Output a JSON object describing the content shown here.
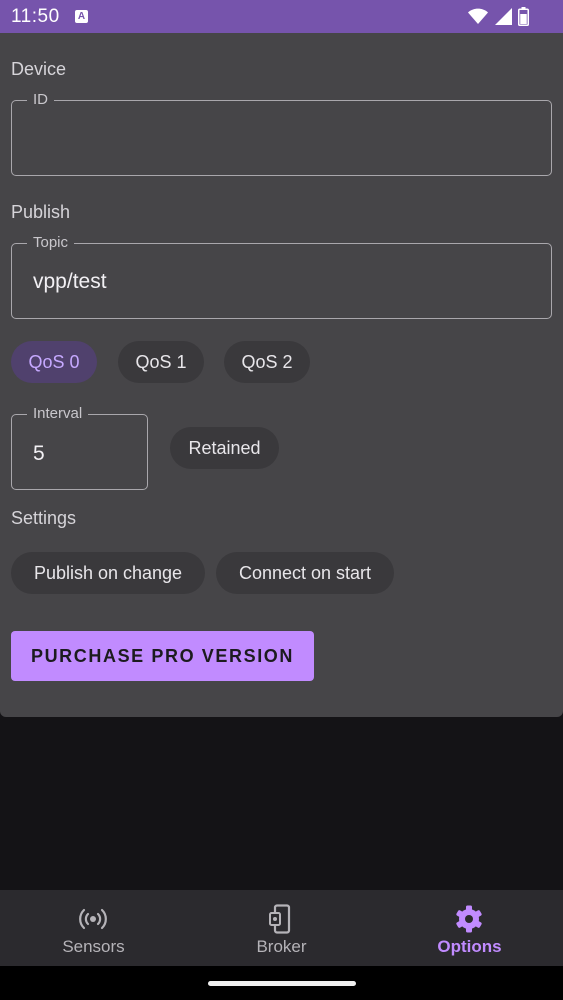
{
  "status_bar": {
    "time": "11:50",
    "app_icon_letter": "A",
    "icons": [
      "wifi-icon",
      "signal-icon",
      "battery-icon"
    ]
  },
  "device": {
    "section_label": "Device",
    "id_field": {
      "label": "ID",
      "value": ""
    }
  },
  "publish": {
    "section_label": "Publish",
    "topic_field": {
      "label": "Topic",
      "value": "vpp/test"
    },
    "qos_chips": [
      {
        "label": "QoS 0",
        "selected": true
      },
      {
        "label": "QoS 1",
        "selected": false
      },
      {
        "label": "QoS 2",
        "selected": false
      }
    ],
    "interval_field": {
      "label": "Interval",
      "value": "5"
    },
    "retained_chip": {
      "label": "Retained",
      "selected": false
    }
  },
  "settings": {
    "section_label": "Settings",
    "chips": [
      {
        "label": "Publish on change",
        "selected": false
      },
      {
        "label": "Connect on start",
        "selected": false
      }
    ]
  },
  "purchase_button": {
    "label": "PURCHASE PRO VERSION"
  },
  "bottom_nav": {
    "items": [
      {
        "label": "Sensors",
        "icon": "sensors-icon",
        "active": false
      },
      {
        "label": "Broker",
        "icon": "broker-icon",
        "active": false
      },
      {
        "label": "Options",
        "icon": "gear-icon",
        "active": true
      }
    ]
  },
  "colors": {
    "accent": "#c18bff",
    "status_bar": "#7654ac",
    "panel": "#464548",
    "chip_selected_bg": "#50416d"
  }
}
